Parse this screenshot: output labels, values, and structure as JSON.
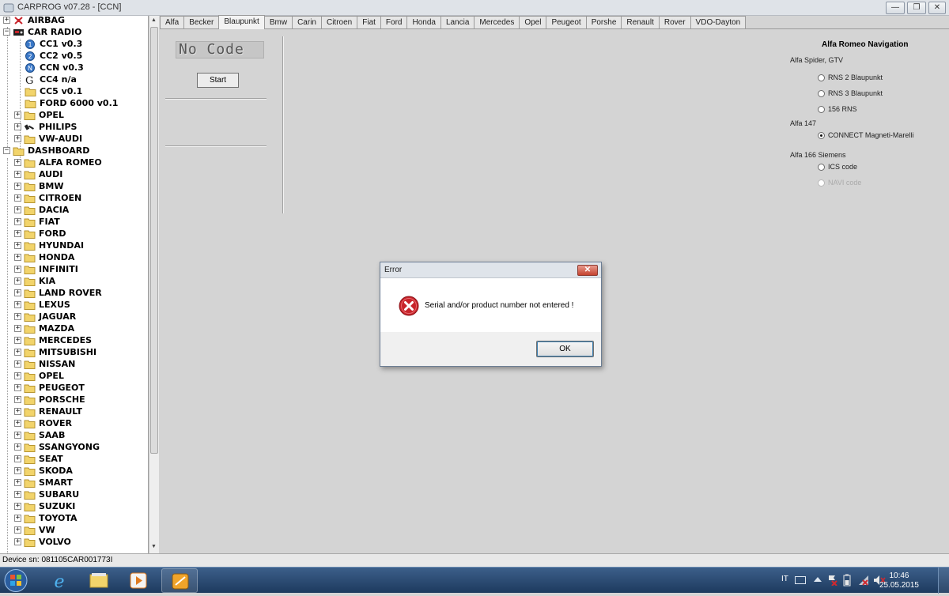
{
  "window": {
    "title": "CARPROG v07.28 - [CCN]",
    "minimize": "—",
    "restore": "❐",
    "close": "✕"
  },
  "tree": {
    "airbag": "AIRBAG",
    "car_radio": "CAR RADIO",
    "radio_items": [
      "CC1 v0.3",
      "CC2 v0.5",
      "CCN v0.3",
      "CC4 n/a",
      "CC5 v0.1",
      "FORD 6000 v0.1"
    ],
    "radio_folders": [
      "OPEL",
      "PHILIPS",
      "VW-AUDI"
    ],
    "dashboard": "DASHBOARD",
    "dashboard_items": [
      "ALFA ROMEO",
      "AUDI",
      "BMW",
      "CITROEN",
      "DACIA",
      "FIAT",
      "FORD",
      "HYUNDAI",
      "HONDA",
      "INFINITI",
      "KIA",
      "LAND ROVER",
      "LEXUS",
      "JAGUAR",
      "MAZDA",
      "MERCEDES",
      "MITSUBISHI",
      "NISSAN",
      "OPEL",
      "PEUGEOT",
      "PORSCHE",
      "RENAULT",
      "ROVER",
      "SAAB",
      "SSANGYONG",
      "SEAT",
      "SKODA",
      "SMART",
      "SUBARU",
      "SUZUKI",
      "TOYOTA",
      "VW",
      "VOLVO"
    ],
    "expand_glyph": "+",
    "collapse_glyph": "−"
  },
  "tabs": [
    "Alfa",
    "Becker",
    "Blaupunkt",
    "Bmw",
    "Carin",
    "Citroen",
    "Fiat",
    "Ford",
    "Honda",
    "Lancia",
    "Mercedes",
    "Opel",
    "Peugeot",
    "Porshe",
    "Renault",
    "Rover",
    "VDO-Dayton"
  ],
  "active_tab": "Blaupunkt",
  "main": {
    "lcd_text": "No Code",
    "start_label": "Start"
  },
  "nav": {
    "title": "Alfa Romeo Navigation",
    "group1": "Alfa Spider, GTV",
    "rns2": "RNS 2 Blaupunkt",
    "rns3": "RNS 3 Blaupunkt",
    "rns156": "156 RNS",
    "group2": "Alfa 147",
    "connect": "CONNECT Magneti-Marelli",
    "group3": "Alfa 166 Siemens",
    "ics": "ICS code",
    "navi": "NAVI code"
  },
  "dialog": {
    "title": "Error",
    "message": "Serial and/or product number not entered !",
    "ok_label": "OK",
    "close_glyph": "✕"
  },
  "status": {
    "device_sn": "Device sn: 081105CAR001773I"
  },
  "taskbar": {
    "language": "IT",
    "time": "10:46",
    "date": "25.05.2015"
  },
  "colors": {
    "error_red": "#c8242b",
    "folder_yellow": "#f2d46b",
    "taskbar": "#27466d"
  }
}
